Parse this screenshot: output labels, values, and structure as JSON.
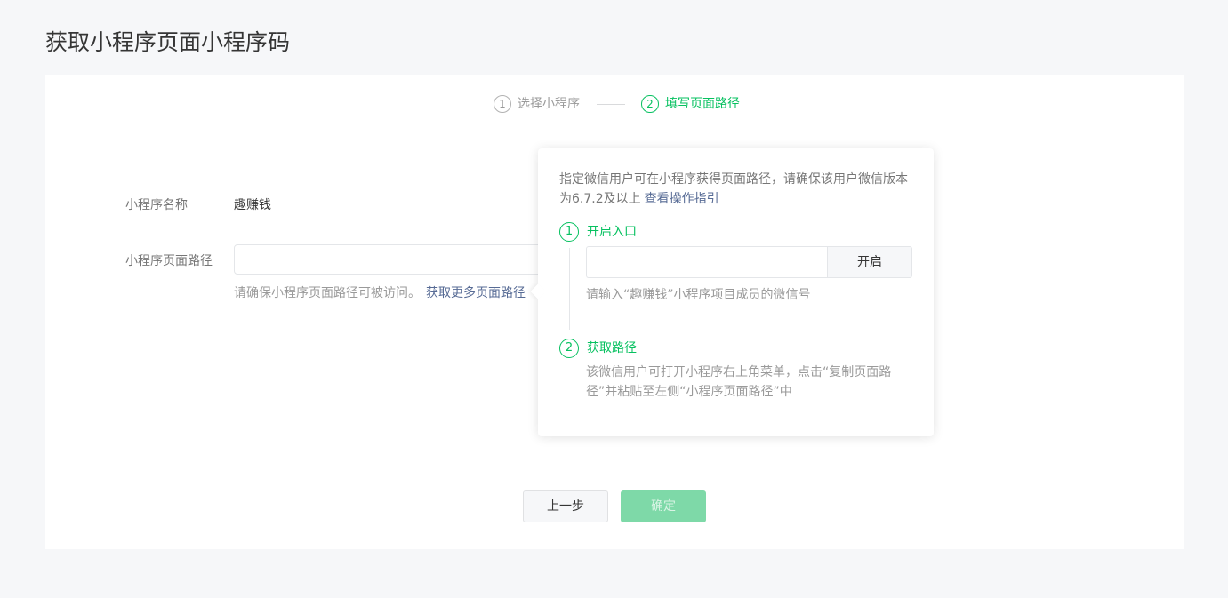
{
  "page": {
    "title": "获取小程序页面小程序码"
  },
  "steps": [
    {
      "number": "1",
      "label": "选择小程序",
      "active": false
    },
    {
      "number": "2",
      "label": "填写页面路径",
      "active": true
    }
  ],
  "form": {
    "name_label": "小程序名称",
    "name_value": "趣赚钱",
    "path_label": "小程序页面路径",
    "path_value": "",
    "path_tip": "请确保小程序页面路径可被访问。",
    "path_more_link": "获取更多页面路径"
  },
  "popover": {
    "description": "指定微信用户可在小程序获得页面路径，请确保该用户微信版本为6.7.2及以上",
    "guide_link": "查看操作指引",
    "step1": {
      "number": "1",
      "title": "开启入口",
      "input_value": "",
      "button_label": "开启",
      "tip": "请输入“趣赚钱”小程序项目成员的微信号"
    },
    "step2": {
      "number": "2",
      "title": "获取路径",
      "description": "该微信用户可打开小程序右上角菜单，点击“复制页面路径”并粘贴至左侧“小程序页面路径”中"
    }
  },
  "footer": {
    "prev_label": "上一步",
    "confirm_label": "确定"
  },
  "colors": {
    "accent": "#07c160",
    "link": "#576b95",
    "background": "#f6f7f9"
  }
}
